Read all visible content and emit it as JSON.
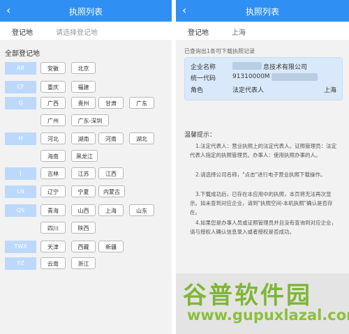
{
  "left": {
    "title": "执照列表",
    "back_icon": "‹",
    "registration_label": "登记地",
    "registration_placeholder": "请选择登记地",
    "section_title": "全部登记地",
    "groups": [
      {
        "label": "AB",
        "provinces": [
          "安徽",
          "北京"
        ]
      },
      {
        "label": "CF",
        "provinces": [
          "重庆",
          "福建"
        ]
      },
      {
        "label": "G",
        "provinces": [
          "广西",
          "贵州",
          "甘肃",
          "广东",
          "广州",
          "广东-深圳"
        ]
      },
      {
        "label": "H",
        "provinces": [
          "河北",
          "湖南",
          "河南",
          "湖北",
          "海南",
          "黑龙江"
        ]
      },
      {
        "label": "J",
        "provinces": [
          "吉林",
          "江苏",
          "江西"
        ]
      },
      {
        "label": "LN",
        "provinces": [
          "辽宁",
          "宁夏",
          "内蒙古"
        ]
      },
      {
        "label": "QS",
        "provinces": [
          "青海",
          "山西",
          "上海",
          "山东",
          "四川",
          "陕西"
        ]
      },
      {
        "label": "TWX",
        "provinces": [
          "天津",
          "西藏",
          "新疆"
        ]
      },
      {
        "label": "YZ",
        "provinces": [
          "云南",
          "浙江"
        ]
      }
    ]
  },
  "right": {
    "title": "执照列表",
    "back_icon": "‹",
    "registration_label": "登记地",
    "registration_value": "上海",
    "found_text": "已查询出1条可下载执照记录",
    "card": {
      "company_label": "企业名称",
      "company_value": "息技术有限公司",
      "code_label": "统一代码",
      "code_value": "91310000M",
      "role_label": "角色",
      "role_value": "法定代表人",
      "region": "上海"
    },
    "tips_title": "温馨提示：",
    "tips": [
      "1.法定代表人：营业执照上的法定代表人。证照管理员：法定代表人指定的执照管理员。办事人：使用执照办事的人。",
      "2.请选择公司名称，\"点击\"进行电子营业执照下载操作。",
      "3.下载成功后，已存在本应用中的执照，本页将无法再次显示。如未查到对应企业，请到\"执照空间-本机执照\"确认是否存在。",
      "4.如果您是办事人员或证照管理员并且没有查询到对应企业，请与授权人确认信息录入或者授权是否成功。"
    ]
  },
  "watermark": {
    "logo_text": "谷普软件园",
    "url": "www.gupuxlazal.com"
  }
}
